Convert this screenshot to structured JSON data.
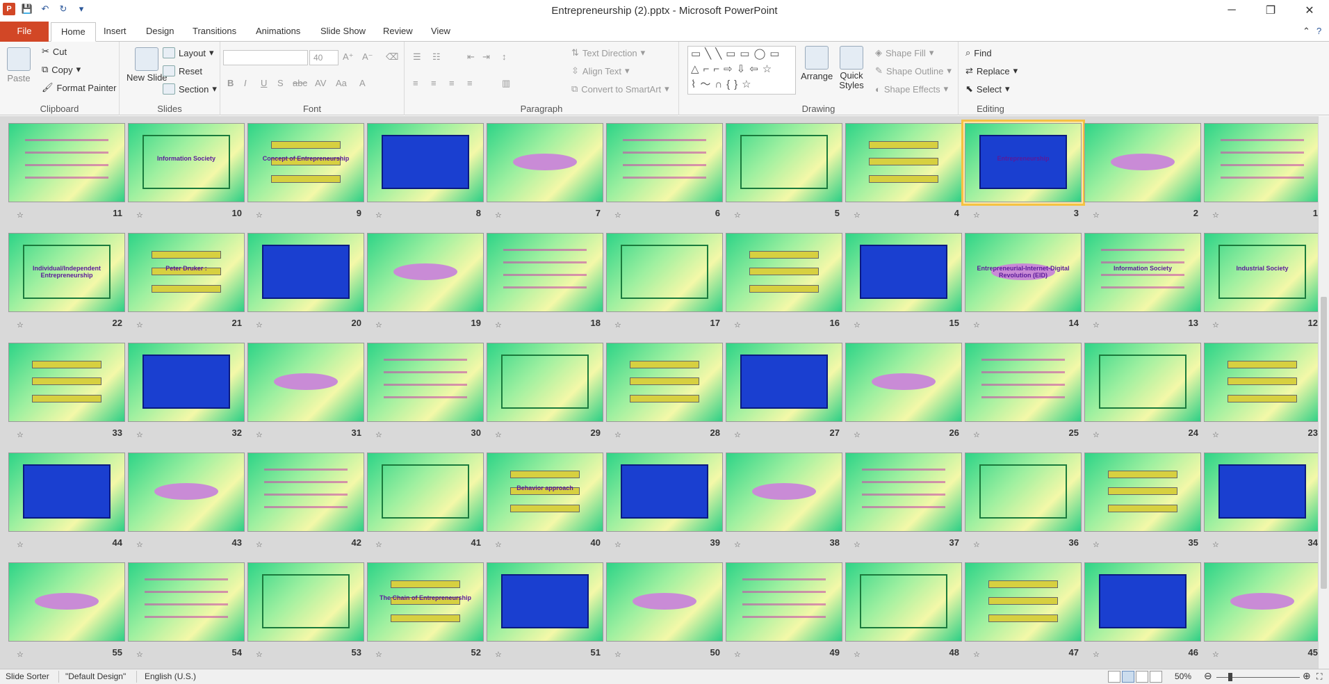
{
  "titlebar": {
    "title": "Entrepreneurship (2).pptx  -  Microsoft PowerPoint",
    "qat": [
      "save-icon",
      "undo-icon",
      "redo-icon",
      "customize-qat-icon"
    ],
    "window": {
      "minimize": "─",
      "restore": "❐",
      "close": "✕"
    }
  },
  "tabs": {
    "file": "File",
    "items": [
      "Home",
      "Insert",
      "Design",
      "Transitions",
      "Animations",
      "Slide Show",
      "Review",
      "View"
    ]
  },
  "ribbon": {
    "clipboard": {
      "label": "Clipboard",
      "paste": "Paste",
      "cut": "Cut",
      "copy": "Copy",
      "format_painter": "Format Painter"
    },
    "slides": {
      "label": "Slides",
      "new_slide": "New Slide",
      "layout": "Layout",
      "reset": "Reset",
      "section": "Section"
    },
    "font": {
      "label": "Font",
      "font_name": "",
      "font_size": "40",
      "styles": [
        "B",
        "I",
        "U",
        "S",
        "abc",
        "AV",
        "Aa",
        "A"
      ]
    },
    "paragraph": {
      "label": "Paragraph",
      "text_direction": "Text Direction",
      "align_text": "Align Text",
      "convert_smartart": "Convert to SmartArt"
    },
    "drawing": {
      "label": "Drawing",
      "arrange": "Arrange",
      "quick_styles": "Quick Styles",
      "shape_fill": "Shape Fill",
      "shape_outline": "Shape Outline",
      "shape_effects": "Shape Effects"
    },
    "editing": {
      "label": "Editing",
      "find": "Find",
      "replace": "Replace",
      "select": "Select"
    }
  },
  "slides": [
    {
      "num": "11"
    },
    {
      "num": "10"
    },
    {
      "num": "9"
    },
    {
      "num": "8"
    },
    {
      "num": "7"
    },
    {
      "num": "6"
    },
    {
      "num": "5"
    },
    {
      "num": "4"
    },
    {
      "num": "3",
      "selected": true
    },
    {
      "num": "2"
    },
    {
      "num": "1"
    },
    {
      "num": "22"
    },
    {
      "num": "21"
    },
    {
      "num": "20"
    },
    {
      "num": "19"
    },
    {
      "num": "18"
    },
    {
      "num": "17"
    },
    {
      "num": "16"
    },
    {
      "num": "15"
    },
    {
      "num": "14"
    },
    {
      "num": "13"
    },
    {
      "num": "12"
    },
    {
      "num": "33"
    },
    {
      "num": "32"
    },
    {
      "num": "31"
    },
    {
      "num": "30"
    },
    {
      "num": "29"
    },
    {
      "num": "28"
    },
    {
      "num": "27"
    },
    {
      "num": "26"
    },
    {
      "num": "25"
    },
    {
      "num": "24"
    },
    {
      "num": "23"
    },
    {
      "num": "44"
    },
    {
      "num": "43"
    },
    {
      "num": "42"
    },
    {
      "num": "41"
    },
    {
      "num": "40"
    },
    {
      "num": "39"
    },
    {
      "num": "38"
    },
    {
      "num": "37"
    },
    {
      "num": "36"
    },
    {
      "num": "35"
    },
    {
      "num": "34"
    },
    {
      "num": "55"
    },
    {
      "num": "54"
    },
    {
      "num": "53"
    },
    {
      "num": "52"
    },
    {
      "num": "51"
    },
    {
      "num": "50"
    },
    {
      "num": "49"
    },
    {
      "num": "48"
    },
    {
      "num": "47"
    },
    {
      "num": "46"
    },
    {
      "num": "45"
    }
  ],
  "slide_texts": {
    "3": "Entrepreneurship",
    "52": "The Chain of Entrepreneurship",
    "13": "Information Society",
    "12": "Industrial Society",
    "10": "Information Society",
    "9": "Concept of Entrepreneurship",
    "14": "Entrepreneurial-Internet-Digital Revolution (EID)",
    "21": "Peter Druker :",
    "40": "Behavior approach",
    "22": "Individual/Independent Entrepreneurship"
  },
  "status": {
    "view": "Slide Sorter",
    "theme": "\"Default Design\"",
    "language": "English (U.S.)",
    "zoom": "50%"
  }
}
